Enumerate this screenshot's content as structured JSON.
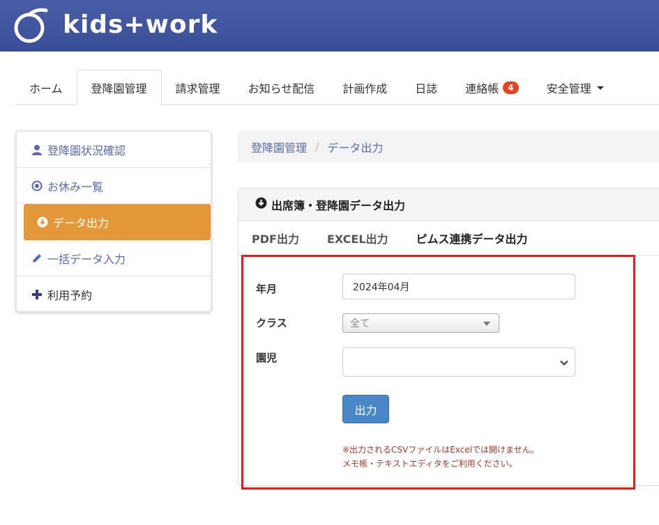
{
  "header": {
    "logo_text": "kids+work",
    "colors": {
      "header_bg": "#3f53a0",
      "accent_orange": "#e59839",
      "badge_red": "#e8431f",
      "highlight_red": "#e11d1d",
      "primary_blue": "#4a87c8"
    }
  },
  "tabs": [
    {
      "label": "ホーム"
    },
    {
      "label": "登降園管理",
      "active": true
    },
    {
      "label": "請求管理"
    },
    {
      "label": "お知らせ配信"
    },
    {
      "label": "計画作成"
    },
    {
      "label": "日誌"
    },
    {
      "label": "連絡帳",
      "badge": "4"
    },
    {
      "label": "安全管理"
    }
  ],
  "sidebar": {
    "items": [
      {
        "label": "登降園状況確認",
        "icon": "user-icon"
      },
      {
        "label": "お休み一覧",
        "icon": "record-circle-icon"
      },
      {
        "label": "データ出力",
        "icon": "download-circle-icon",
        "active": true
      },
      {
        "label": "一括データ入力",
        "icon": "pencil-icon"
      },
      {
        "label": "利用予約",
        "icon": "plus-icon"
      }
    ]
  },
  "breadcrumb": {
    "parent": "登降園管理",
    "separator": "/",
    "current": "データ出力"
  },
  "panel": {
    "title": "出席簿・登降園データ出力",
    "subtabs": [
      {
        "label": "PDF出力"
      },
      {
        "label": "EXCEL出力"
      },
      {
        "label": "ピムス連携データ出力",
        "active": true
      }
    ]
  },
  "form": {
    "year_month_label": "年月",
    "year_month_value": "2024年04月",
    "class_label": "クラス",
    "class_value": "全て",
    "child_label": "園児",
    "child_value": "",
    "submit_label": "出力",
    "note_line1": "※出力されるCSVファイルはExcelでは開けません。",
    "note_line2": "メモ帳・テキストエディタをご利用ください。"
  }
}
